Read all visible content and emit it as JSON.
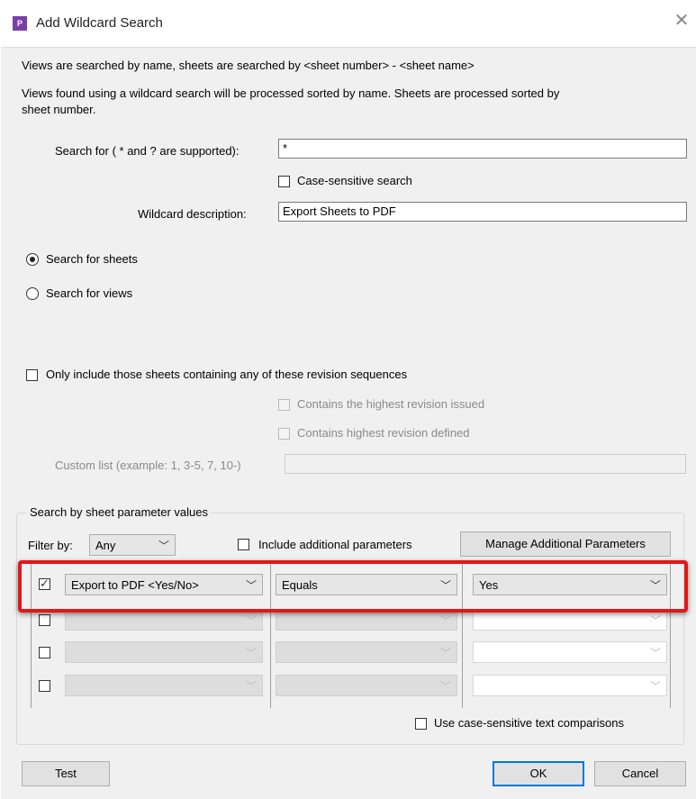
{
  "window": {
    "title": "Add Wildcard Search",
    "icon_text": "P"
  },
  "info": {
    "line1": "Views are searched by name, sheets are searched by <sheet number> - <sheet name>",
    "line2a": "Views found using a wildcard search will be processed sorted by name.  Sheets are processed sorted by",
    "line2b": "sheet number."
  },
  "search": {
    "label": "Search for ( * and ? are supported):",
    "value": "*",
    "case_sensitive_label": "Case-sensitive search",
    "description_label": "Wildcard description:",
    "description_value": "Export Sheets to PDF"
  },
  "mode": {
    "sheets_label": "Search for sheets",
    "views_label": "Search for views",
    "selected": "sheets"
  },
  "revision": {
    "only_include_label": "Only include those sheets containing any of these revision sequences",
    "highest_issued_label": "Contains the highest revision issued",
    "highest_defined_label": "Contains highest revision defined",
    "custom_list_label": "Custom list (example:  1, 3-5, 7, 10-)"
  },
  "param_group": {
    "title": "Search by sheet parameter values",
    "filter_by_label": "Filter by:",
    "filter_by_value": "Any",
    "include_additional_label": "Include additional parameters",
    "manage_button": "Manage Additional Parameters",
    "rows": [
      {
        "checked": true,
        "parameter": "Export to PDF <Yes/No>",
        "operator": "Equals",
        "value": "Yes"
      },
      {
        "checked": false,
        "parameter": "",
        "operator": "",
        "value": ""
      },
      {
        "checked": false,
        "parameter": "",
        "operator": "",
        "value": ""
      },
      {
        "checked": false,
        "parameter": "",
        "operator": "",
        "value": ""
      }
    ],
    "case_sensitive_text_label": "Use case-sensitive text comparisons"
  },
  "buttons": {
    "test": "Test",
    "ok": "OK",
    "cancel": "Cancel"
  },
  "colors": {
    "highlight": "#e01818",
    "default_button_border": "#0078d7",
    "app_icon": "#7a3fa8"
  }
}
